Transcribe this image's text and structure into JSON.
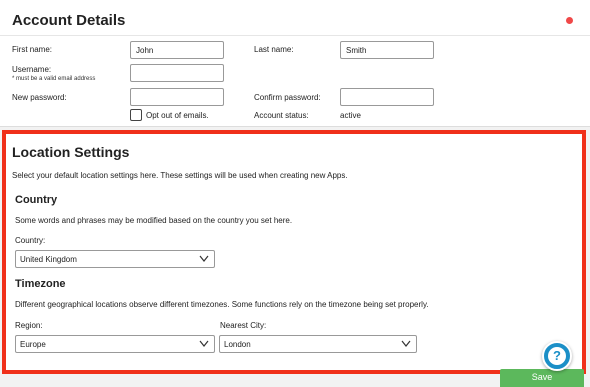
{
  "account": {
    "title": "Account Details",
    "first_name_label": "First name:",
    "first_name_value": "John",
    "last_name_label": "Last name:",
    "last_name_value": "Smith",
    "username_label": "Username:",
    "username_hint": "* must be a valid email address",
    "username_value": "",
    "new_password_label": "New password:",
    "new_password_value": "",
    "confirm_password_label": "Confirm password:",
    "confirm_password_value": "",
    "opt_out_label": "Opt out of emails.",
    "opt_out_checked": false,
    "status_label": "Account status:",
    "status_value": "active"
  },
  "location": {
    "title": "Location Settings",
    "description": "Select your default location settings here. These settings will be used when creating new Apps.",
    "country_heading": "Country",
    "country_description": "Some words and phrases may be modified based on the country you set here.",
    "country_label": "Country:",
    "country_value": "United Kingdom",
    "timezone_heading": "Timezone",
    "timezone_description": "Different geographical locations observe different timezones. Some functions rely on the timezone being set properly.",
    "region_label": "Region:",
    "region_value": "Europe",
    "city_label": "Nearest City:",
    "city_value": "London"
  },
  "actions": {
    "save_label": "Save"
  },
  "colors": {
    "highlight_border": "#f0301a",
    "save_button": "#5cb85c",
    "help_button": "#1b8fc7",
    "status_dot": "#f04848"
  },
  "icons": [
    "chevron-down-icon",
    "help-icon",
    "status-dot-icon"
  ]
}
